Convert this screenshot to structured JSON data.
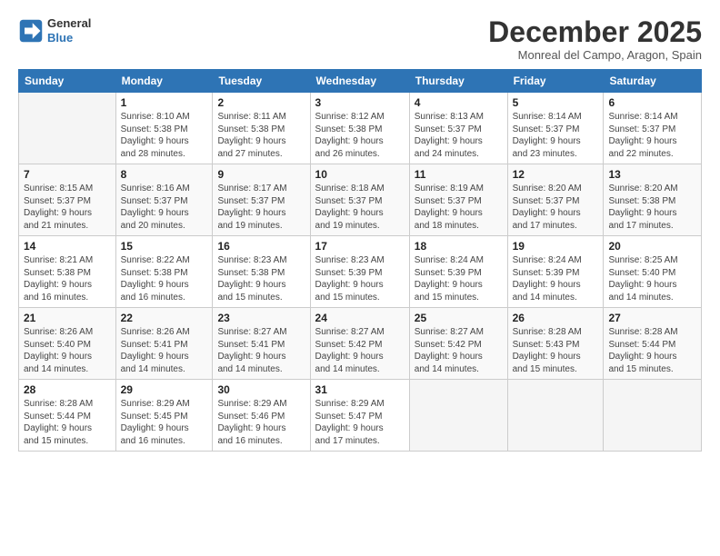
{
  "header": {
    "logo_line1": "General",
    "logo_line2": "Blue",
    "month": "December 2025",
    "location": "Monreal del Campo, Aragon, Spain"
  },
  "days_of_week": [
    "Sunday",
    "Monday",
    "Tuesday",
    "Wednesday",
    "Thursday",
    "Friday",
    "Saturday"
  ],
  "weeks": [
    [
      {
        "day": "",
        "empty": true
      },
      {
        "day": "1",
        "sunrise": "8:10 AM",
        "sunset": "5:38 PM",
        "daylight": "9 hours and 28 minutes."
      },
      {
        "day": "2",
        "sunrise": "8:11 AM",
        "sunset": "5:38 PM",
        "daylight": "9 hours and 27 minutes."
      },
      {
        "day": "3",
        "sunrise": "8:12 AM",
        "sunset": "5:38 PM",
        "daylight": "9 hours and 26 minutes."
      },
      {
        "day": "4",
        "sunrise": "8:13 AM",
        "sunset": "5:37 PM",
        "daylight": "9 hours and 24 minutes."
      },
      {
        "day": "5",
        "sunrise": "8:14 AM",
        "sunset": "5:37 PM",
        "daylight": "9 hours and 23 minutes."
      },
      {
        "day": "6",
        "sunrise": "8:14 AM",
        "sunset": "5:37 PM",
        "daylight": "9 hours and 22 minutes."
      }
    ],
    [
      {
        "day": "7",
        "sunrise": "8:15 AM",
        "sunset": "5:37 PM",
        "daylight": "9 hours and 21 minutes."
      },
      {
        "day": "8",
        "sunrise": "8:16 AM",
        "sunset": "5:37 PM",
        "daylight": "9 hours and 20 minutes."
      },
      {
        "day": "9",
        "sunrise": "8:17 AM",
        "sunset": "5:37 PM",
        "daylight": "9 hours and 19 minutes."
      },
      {
        "day": "10",
        "sunrise": "8:18 AM",
        "sunset": "5:37 PM",
        "daylight": "9 hours and 19 minutes."
      },
      {
        "day": "11",
        "sunrise": "8:19 AM",
        "sunset": "5:37 PM",
        "daylight": "9 hours and 18 minutes."
      },
      {
        "day": "12",
        "sunrise": "8:20 AM",
        "sunset": "5:37 PM",
        "daylight": "9 hours and 17 minutes."
      },
      {
        "day": "13",
        "sunrise": "8:20 AM",
        "sunset": "5:38 PM",
        "daylight": "9 hours and 17 minutes."
      }
    ],
    [
      {
        "day": "14",
        "sunrise": "8:21 AM",
        "sunset": "5:38 PM",
        "daylight": "9 hours and 16 minutes."
      },
      {
        "day": "15",
        "sunrise": "8:22 AM",
        "sunset": "5:38 PM",
        "daylight": "9 hours and 16 minutes."
      },
      {
        "day": "16",
        "sunrise": "8:23 AM",
        "sunset": "5:38 PM",
        "daylight": "9 hours and 15 minutes."
      },
      {
        "day": "17",
        "sunrise": "8:23 AM",
        "sunset": "5:39 PM",
        "daylight": "9 hours and 15 minutes."
      },
      {
        "day": "18",
        "sunrise": "8:24 AM",
        "sunset": "5:39 PM",
        "daylight": "9 hours and 15 minutes."
      },
      {
        "day": "19",
        "sunrise": "8:24 AM",
        "sunset": "5:39 PM",
        "daylight": "9 hours and 14 minutes."
      },
      {
        "day": "20",
        "sunrise": "8:25 AM",
        "sunset": "5:40 PM",
        "daylight": "9 hours and 14 minutes."
      }
    ],
    [
      {
        "day": "21",
        "sunrise": "8:26 AM",
        "sunset": "5:40 PM",
        "daylight": "9 hours and 14 minutes."
      },
      {
        "day": "22",
        "sunrise": "8:26 AM",
        "sunset": "5:41 PM",
        "daylight": "9 hours and 14 minutes."
      },
      {
        "day": "23",
        "sunrise": "8:27 AM",
        "sunset": "5:41 PM",
        "daylight": "9 hours and 14 minutes."
      },
      {
        "day": "24",
        "sunrise": "8:27 AM",
        "sunset": "5:42 PM",
        "daylight": "9 hours and 14 minutes."
      },
      {
        "day": "25",
        "sunrise": "8:27 AM",
        "sunset": "5:42 PM",
        "daylight": "9 hours and 14 minutes."
      },
      {
        "day": "26",
        "sunrise": "8:28 AM",
        "sunset": "5:43 PM",
        "daylight": "9 hours and 15 minutes."
      },
      {
        "day": "27",
        "sunrise": "8:28 AM",
        "sunset": "5:44 PM",
        "daylight": "9 hours and 15 minutes."
      }
    ],
    [
      {
        "day": "28",
        "sunrise": "8:28 AM",
        "sunset": "5:44 PM",
        "daylight": "9 hours and 15 minutes."
      },
      {
        "day": "29",
        "sunrise": "8:29 AM",
        "sunset": "5:45 PM",
        "daylight": "9 hours and 16 minutes."
      },
      {
        "day": "30",
        "sunrise": "8:29 AM",
        "sunset": "5:46 PM",
        "daylight": "9 hours and 16 minutes."
      },
      {
        "day": "31",
        "sunrise": "8:29 AM",
        "sunset": "5:47 PM",
        "daylight": "9 hours and 17 minutes."
      },
      {
        "day": "",
        "empty": true
      },
      {
        "day": "",
        "empty": true
      },
      {
        "day": "",
        "empty": true
      }
    ]
  ]
}
